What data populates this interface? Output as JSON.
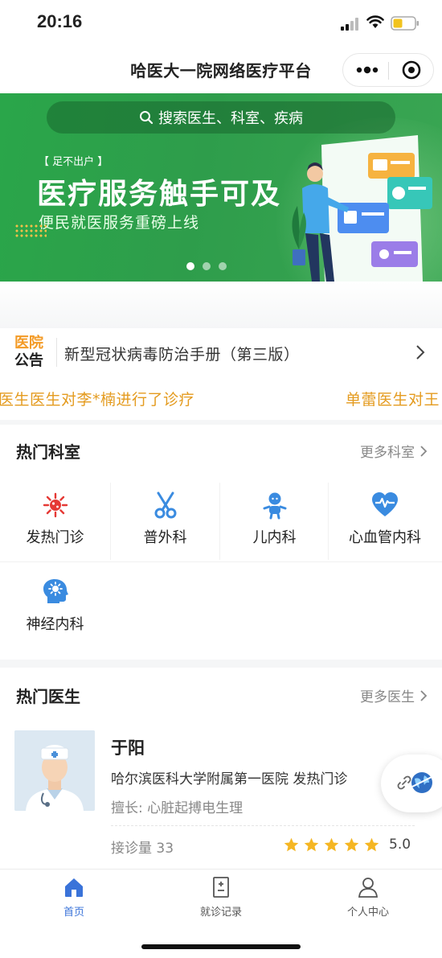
{
  "status_bar": {
    "time": "20:16"
  },
  "title_bar": {
    "title": "哈医大一院网络医疗平台"
  },
  "banner": {
    "search_placeholder": "搜索医生、科室、疾病",
    "tagline": "【 足不出户 】",
    "headline": "医疗服务触手可及",
    "subline": "便民就医服务重磅上线",
    "slide_count": 3,
    "active_slide": 1,
    "brand_color": "#2aa64a"
  },
  "notice": {
    "badge_line1": "医院",
    "badge_line2": "公告",
    "text": "新型冠状病毒防治手册（第三版）"
  },
  "ticker": {
    "items": [
      "医生医生对李*楠进行了诊疗",
      "单蕾医生对王"
    ]
  },
  "departments": {
    "title": "热门科室",
    "more": "更多科室",
    "items": [
      {
        "label": "发热门诊",
        "icon": "virus-icon"
      },
      {
        "label": "普外科",
        "icon": "scissors-icon"
      },
      {
        "label": "儿内科",
        "icon": "baby-icon"
      },
      {
        "label": "心血管内科",
        "icon": "heart-pulse-icon"
      },
      {
        "label": "神经内科",
        "icon": "brain-icon"
      }
    ]
  },
  "doctors": {
    "title": "热门医生",
    "more": "更多医生",
    "items": [
      {
        "name": "于阳",
        "hospital": "哈尔滨医科大学附属第一医院 发热门诊",
        "specialty": "擅长: 心脏起搏电生理",
        "consult_count": "接诊量 33",
        "rating": 5,
        "score": "5.0"
      }
    ]
  },
  "tabbar": {
    "items": [
      {
        "label": "首页",
        "icon": "home-icon",
        "active": true
      },
      {
        "label": "就诊记录",
        "icon": "records-icon",
        "active": false
      },
      {
        "label": "个人中心",
        "icon": "user-icon",
        "active": false
      }
    ]
  },
  "colors": {
    "accent": "#3a73d9",
    "notice_orange": "#f39a25",
    "ticker_orange": "#e49b1f",
    "star": "#f5b623"
  }
}
